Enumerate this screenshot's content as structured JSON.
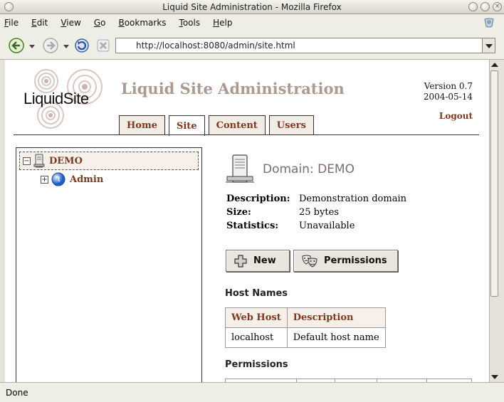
{
  "window": {
    "title": "Liquid Site Administration - Mozilla Firefox"
  },
  "menu": [
    "File",
    "Edit",
    "View",
    "Go",
    "Bookmarks",
    "Tools",
    "Help"
  ],
  "menu_access_keys": [
    "F",
    "E",
    "V",
    "G",
    "B",
    "T",
    "H"
  ],
  "address": {
    "url": "http://localhost:8080/admin/site.html"
  },
  "status": {
    "text": "Done"
  },
  "header": {
    "logo_text": "LiquidSite",
    "title": "Liquid Site Administration",
    "version": "Version 0.7",
    "date": "2004-05-14",
    "logout": "Logout"
  },
  "tabs": [
    {
      "label": "Home",
      "active": false
    },
    {
      "label": "Site",
      "active": true
    },
    {
      "label": "Content",
      "active": false
    },
    {
      "label": "Users",
      "active": false
    }
  ],
  "tree": {
    "root": {
      "label": "DEMO",
      "expander": "−"
    },
    "children": [
      {
        "label": "Admin",
        "expander": "+"
      }
    ]
  },
  "domain": {
    "title": "Domain: DEMO",
    "properties": [
      {
        "key": "Description:",
        "value": "Demonstration domain"
      },
      {
        "key": "Size:",
        "value": "25 bytes"
      },
      {
        "key": "Statistics:",
        "value": "Unavailable"
      }
    ]
  },
  "buttons": {
    "new": "New",
    "permissions": "Permissions"
  },
  "host_names": {
    "heading": "Host Names",
    "columns": [
      "Web Host",
      "Description"
    ],
    "rows": [
      [
        "localhost",
        "Default host name"
      ]
    ]
  },
  "permissions": {
    "heading": "Permissions"
  },
  "colors": {
    "link": "#7b3a1e",
    "title": "#a99a94",
    "tab_bg": "#f2ece6"
  }
}
